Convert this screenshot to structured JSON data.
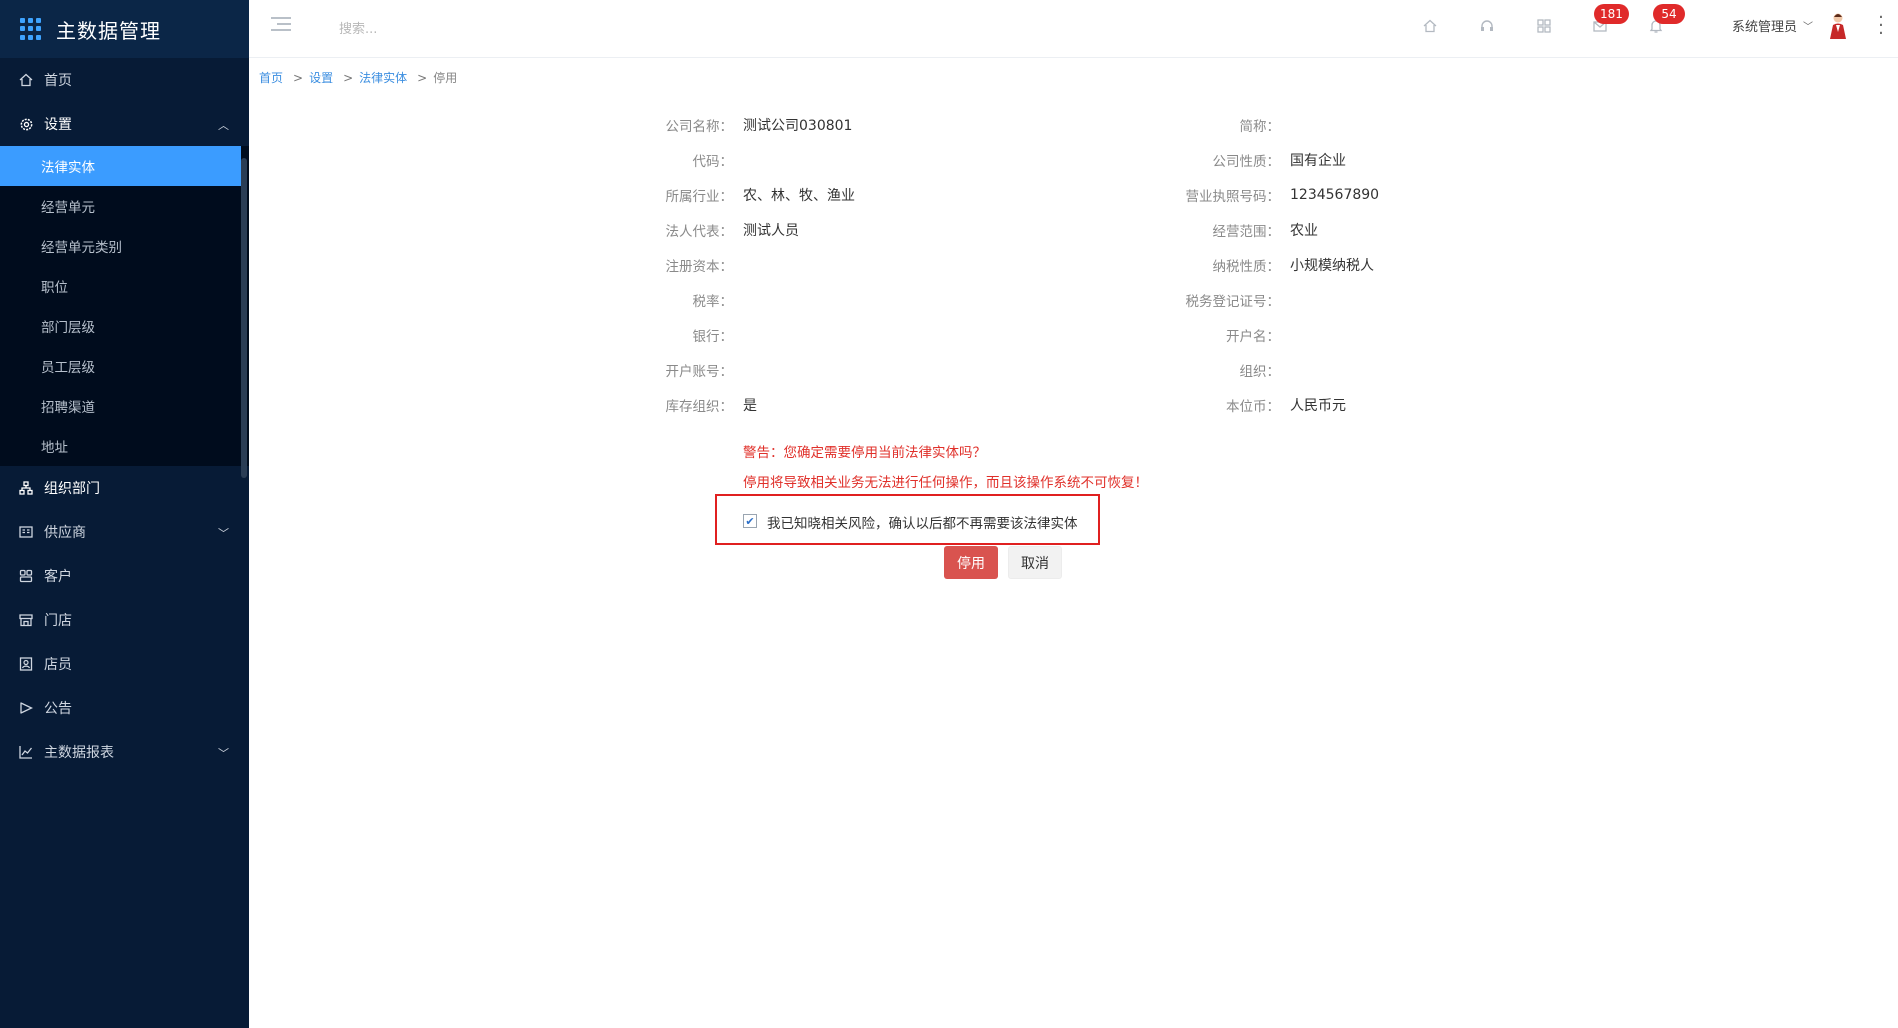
{
  "app": {
    "title": "主数据管理"
  },
  "sidebar": {
    "items": [
      {
        "label": "首页",
        "icon": "home-icon"
      },
      {
        "label": "设置",
        "icon": "gear-icon",
        "open": true,
        "children": [
          "法律实体",
          "经营单元",
          "经营单元类别",
          "职位",
          "部门层级",
          "员工层级",
          "招聘渠道",
          "地址"
        ],
        "active_child": "法律实体"
      },
      {
        "label": "组织部门",
        "icon": "org-chart-icon"
      },
      {
        "label": "供应商",
        "icon": "supplier-icon",
        "has_children": true
      },
      {
        "label": "客户",
        "icon": "customer-icon"
      },
      {
        "label": "门店",
        "icon": "store-icon"
      },
      {
        "label": "店员",
        "icon": "clerk-icon"
      },
      {
        "label": "公告",
        "icon": "announcement-icon"
      },
      {
        "label": "主数据报表",
        "icon": "chart-icon",
        "has_children": true
      }
    ]
  },
  "header": {
    "search_placeholder": "搜索...",
    "badges": {
      "messages": "181",
      "notifications": "54"
    },
    "user_name": "系统管理员"
  },
  "breadcrumb": [
    "首页",
    "设置",
    "法律实体",
    "停用"
  ],
  "form": {
    "rows": [
      {
        "left": {
          "label": "公司名称：",
          "value": "测试公司030801"
        },
        "right": {
          "label": "简称：",
          "value": ""
        }
      },
      {
        "left": {
          "label": "代码：",
          "value": ""
        },
        "right": {
          "label": "公司性质：",
          "value": "国有企业"
        }
      },
      {
        "left": {
          "label": "所属行业：",
          "value": "农、林、牧、渔业"
        },
        "right": {
          "label": "营业执照号码：",
          "value": "1234567890"
        }
      },
      {
        "left": {
          "label": "法人代表：",
          "value": "测试人员"
        },
        "right": {
          "label": "经营范围：",
          "value": "农业"
        }
      },
      {
        "left": {
          "label": "注册资本：",
          "value": ""
        },
        "right": {
          "label": "纳税性质：",
          "value": "小规模纳税人"
        }
      },
      {
        "left": {
          "label": "税率：",
          "value": ""
        },
        "right": {
          "label": "税务登记证号：",
          "value": ""
        }
      },
      {
        "left": {
          "label": "银行：",
          "value": ""
        },
        "right": {
          "label": "开户名：",
          "value": ""
        }
      },
      {
        "left": {
          "label": "开户账号：",
          "value": ""
        },
        "right": {
          "label": "组织：",
          "value": ""
        }
      },
      {
        "left": {
          "label": "库存组织：",
          "value": "是"
        },
        "right": {
          "label": "本位币：",
          "value": "人民币元"
        }
      }
    ]
  },
  "warning": {
    "line1": "警告：您确定需要停用当前法律实体吗？",
    "line2": "停用将导致相关业务无法进行任何操作，而且该操作系统不可恢复！"
  },
  "confirm": {
    "checked": true,
    "text": "我已知晓相关风险，确认以后都不再需要该法律实体"
  },
  "buttons": {
    "disable": "停用",
    "cancel": "取消"
  },
  "colors": {
    "sidebar_bg": "#071b36",
    "active_blue": "#3b9cff",
    "danger": "#d9534f",
    "warning_text": "#e0302a",
    "badge": "#e02a2a"
  }
}
